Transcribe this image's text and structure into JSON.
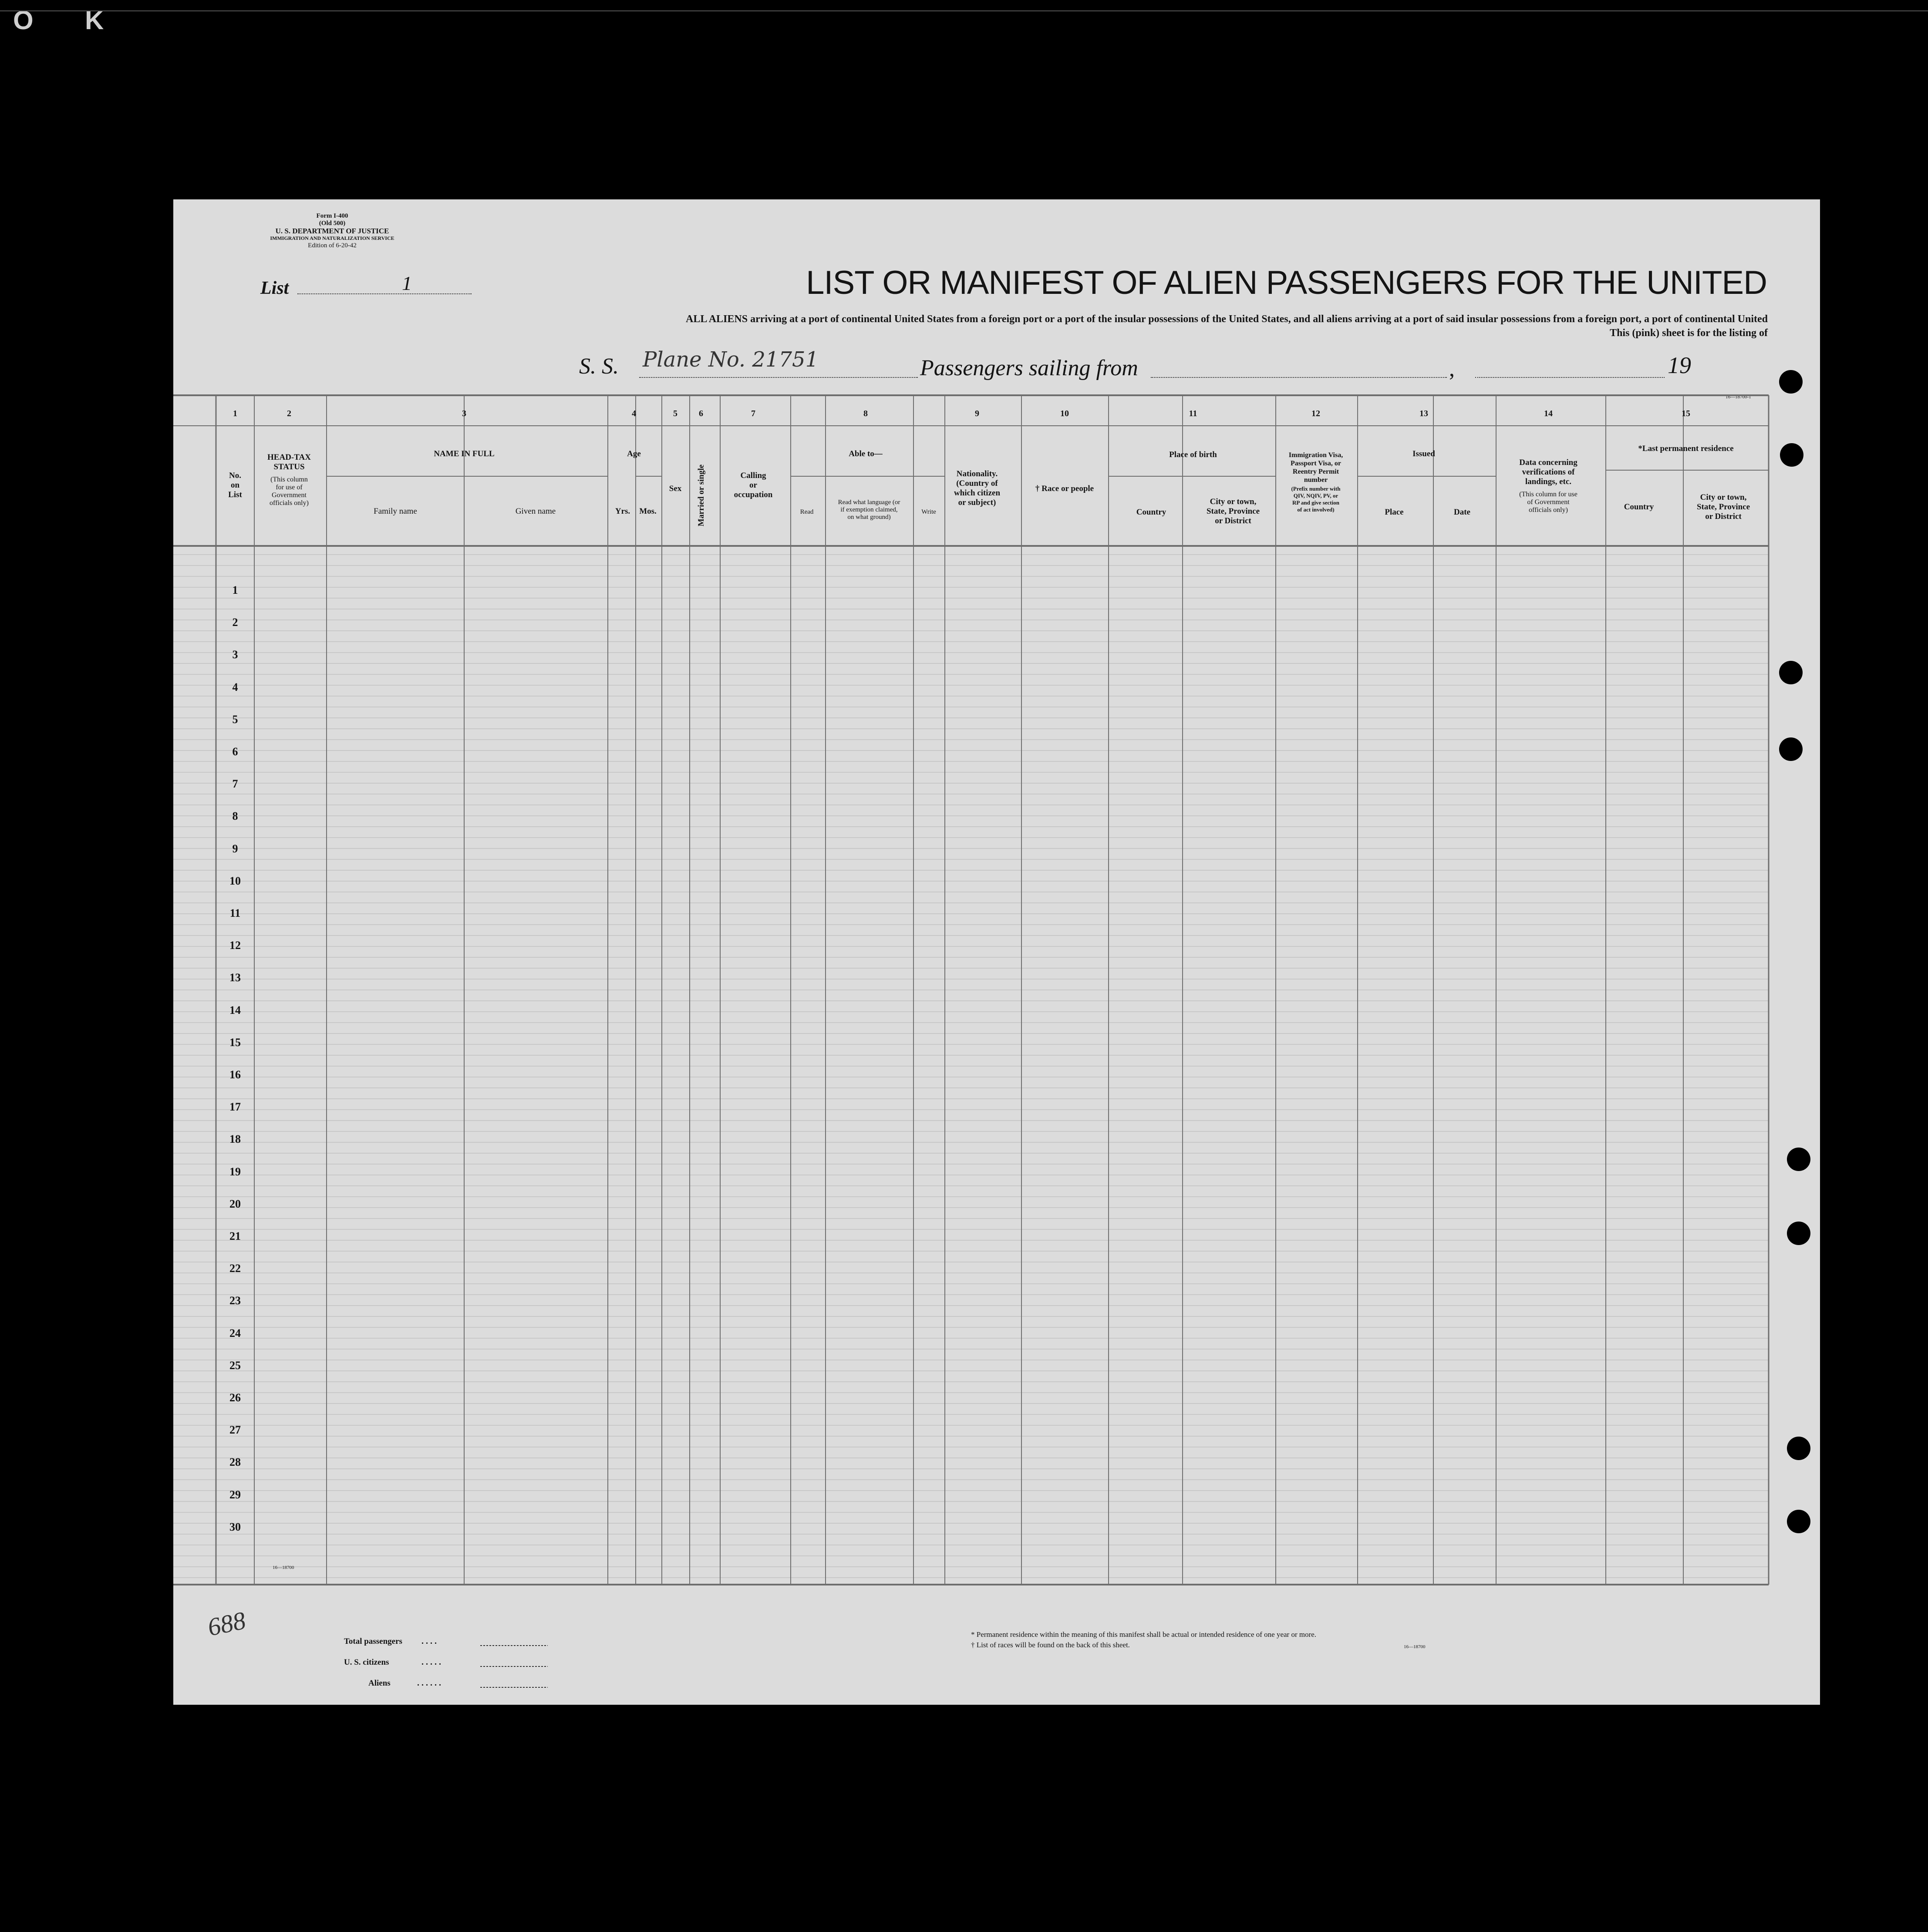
{
  "corner_marks": [
    "O",
    "K"
  ],
  "form_header": {
    "form_no": "Form I-400",
    "old_no": "(Old 500)",
    "department": "U. S. DEPARTMENT OF JUSTICE",
    "service": "IMMIGRATION AND NATURALIZATION SERVICE",
    "edition": "Edition of 6-20-42"
  },
  "list": {
    "label": "List",
    "value": "1"
  },
  "title": "LIST OR MANIFEST OF ALIEN PASSENGERS FOR THE UNITED",
  "subtitle_1": "ALL ALIENS arriving at a port of continental United States from a foreign port or a port of the insular possessions of the United States, and all aliens arriving at a port of said insular possessions from a foreign port, a port of continental United",
  "subtitle_2": "This (pink) sheet is for the listing of",
  "vessel": {
    "label": "S. S.",
    "value": "Plane No. 21751",
    "sailing_label": "Passengers sailing from",
    "year_prefix": "19"
  },
  "print_code_top": "16—18700-1",
  "print_code_bottom": "16—18700",
  "print_code_footer": "16—18700",
  "column_numbers": [
    "1",
    "2",
    "3",
    "4",
    "5",
    "6",
    "7",
    "8",
    "9",
    "10",
    "11",
    "12",
    "13",
    "14",
    "15"
  ],
  "headers": {
    "no_on_list": [
      "No.",
      "on",
      "List"
    ],
    "head_tax": [
      "HEAD-TAX",
      "STATUS",
      "(This column",
      "for use of",
      "Government",
      "officials only)"
    ],
    "name_in_full": "NAME IN FULL",
    "family_name": "Family name",
    "given_name": "Given name",
    "age": "Age",
    "yrs": "Yrs.",
    "mos": "Mos.",
    "sex": "Sex",
    "married": "Married or single",
    "calling": [
      "Calling",
      "or",
      "occupation"
    ],
    "able_to": "Able to—",
    "read": "Read",
    "read_what": [
      "Read what language (or",
      "if exemption claimed,",
      "on what ground)"
    ],
    "write": "Write",
    "nationality": [
      "Nationality.",
      "(Country of",
      "which citizen",
      "or subject)"
    ],
    "race": "† Race or people",
    "place_of_birth": "Place of birth",
    "country": "Country",
    "city": [
      "City or town,",
      "State, Province",
      "or District"
    ],
    "visa": [
      "Immigration Visa,",
      "Passport Visa, or",
      "Reentry Permit",
      "number",
      "(Prefix number with",
      "QIV, NQIV, PV, or",
      "RP and give section",
      "of act involved)"
    ],
    "issued": "Issued",
    "place": "Place",
    "date": "Date",
    "data_concerning": [
      "Data concerning",
      "verifications of",
      "landings, etc.",
      "(This column for use",
      "of Government",
      "officials only)"
    ],
    "last_residence": "*Last permanent residence",
    "res_country": "Country",
    "res_city": [
      "City or town,",
      "State, Province",
      "or District"
    ]
  },
  "rows": [
    "1",
    "2",
    "3",
    "4",
    "5",
    "6",
    "7",
    "8",
    "9",
    "10",
    "11",
    "12",
    "13",
    "14",
    "15",
    "16",
    "17",
    "18",
    "19",
    "20",
    "21",
    "22",
    "23",
    "24",
    "25",
    "26",
    "27",
    "28",
    "29",
    "30"
  ],
  "margin_note": "688",
  "totals": [
    {
      "label": "Total passengers"
    },
    {
      "label": "U. S. citizens"
    },
    {
      "label": "Aliens"
    }
  ],
  "footnotes": [
    "* Permanent residence within the meaning of this manifest shall be actual or intended residence of one year or more.",
    "† List of races will be found on the back of this sheet."
  ],
  "colors": {
    "paper": "#dcdcdc",
    "background": "#000000",
    "ink": "#141414",
    "rule": "#6e6e6e",
    "faint_rule": "#b4b4b4"
  }
}
